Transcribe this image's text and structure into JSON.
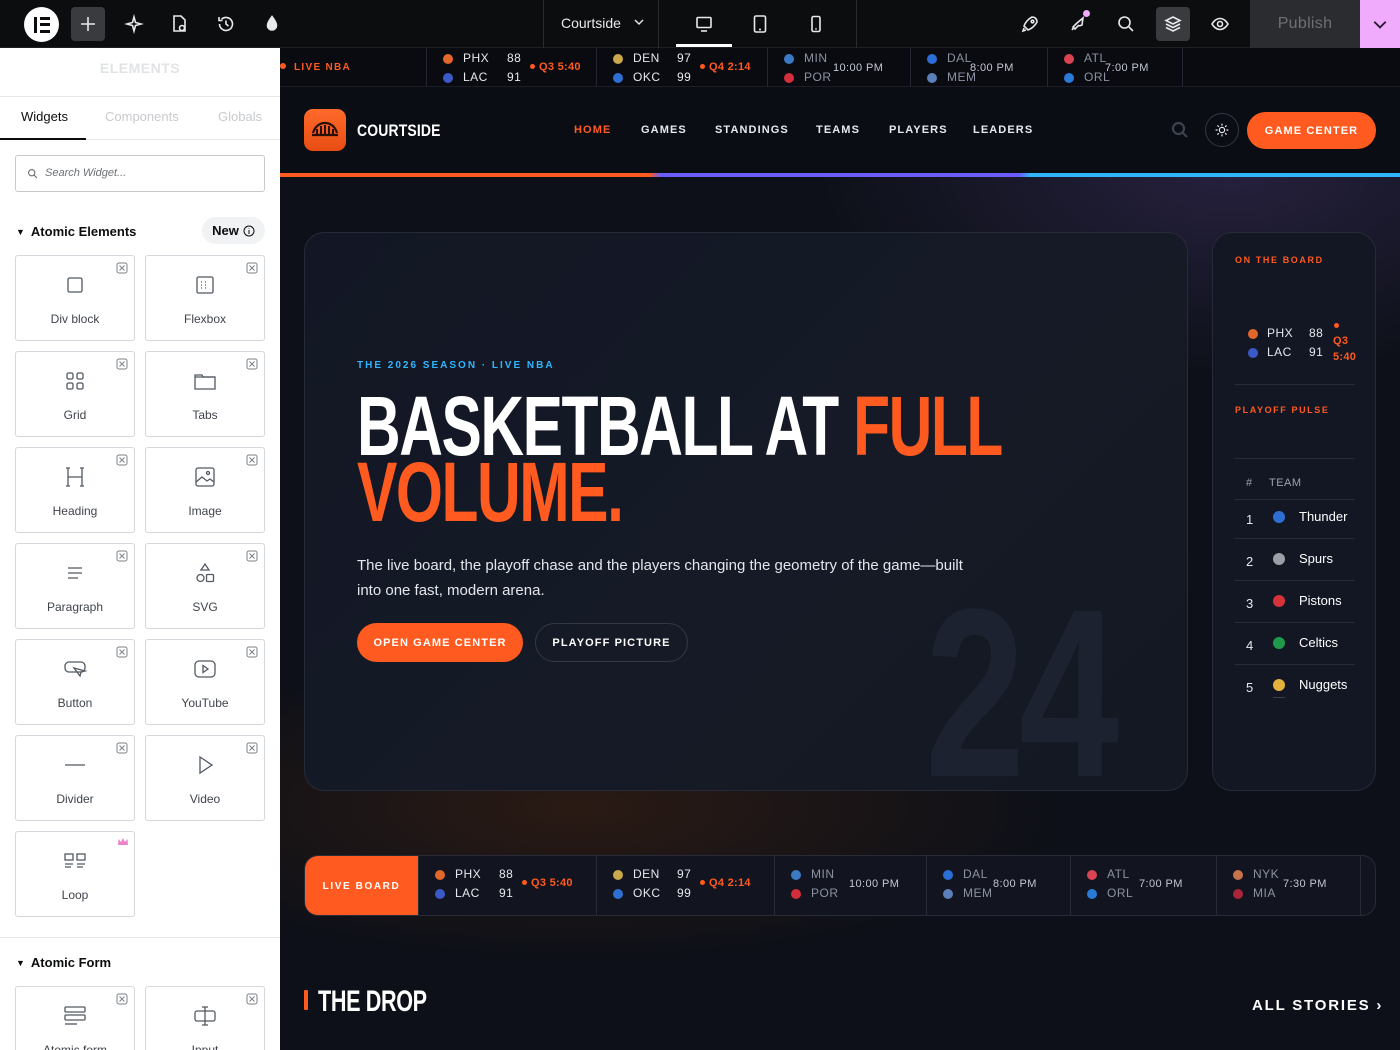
{
  "editor": {
    "site_selector": "Courtside",
    "publish_label": "Publish",
    "toolbar_icons": [
      "elementor-logo-icon",
      "add-icon",
      "ai-sparkle-icon",
      "page-settings-icon",
      "history-icon",
      "theme-style-icon",
      "desktop-icon",
      "tablet-icon",
      "mobile-icon",
      "rocket-icon",
      "notifications-icon",
      "search-icon",
      "structure-icon",
      "preview-icon",
      "chevron-down-icon"
    ],
    "accent_color": "#f0abfc"
  },
  "panel": {
    "title": "ELEMENTS",
    "tabs": [
      "Widgets",
      "Components",
      "Globals"
    ],
    "search_placeholder": "Search Widget...",
    "section_atomic": "Atomic Elements",
    "new_badge": "New",
    "widgets": [
      {
        "label": "Div block",
        "icon": "div-block-icon"
      },
      {
        "label": "Flexbox",
        "icon": "flexbox-icon"
      },
      {
        "label": "Grid",
        "icon": "grid-icon"
      },
      {
        "label": "Tabs",
        "icon": "tabs-icon"
      },
      {
        "label": "Heading",
        "icon": "heading-icon"
      },
      {
        "label": "Image",
        "icon": "image-icon"
      },
      {
        "label": "Paragraph",
        "icon": "paragraph-icon"
      },
      {
        "label": "SVG",
        "icon": "svg-icon"
      },
      {
        "label": "Button",
        "icon": "button-icon"
      },
      {
        "label": "YouTube",
        "icon": "youtube-icon"
      },
      {
        "label": "Divider",
        "icon": "divider-icon"
      },
      {
        "label": "Video",
        "icon": "video-icon"
      },
      {
        "label": "Loop",
        "icon": "loop-icon"
      }
    ],
    "section_form": "Atomic Form",
    "form_widgets": [
      {
        "label": "Atomic form",
        "icon": "form-icon"
      },
      {
        "label": "Input",
        "icon": "input-icon"
      }
    ]
  },
  "site": {
    "ticker": {
      "label": "LIVE NBA",
      "games": [
        {
          "t1": "PHX",
          "s1": "88",
          "t2": "LAC",
          "s2": "91",
          "status": "Q3 5:40",
          "live": true
        },
        {
          "t1": "DEN",
          "s1": "97",
          "t2": "OKC",
          "s2": "99",
          "status": "Q4 2:14",
          "live": true
        },
        {
          "t1": "MIN",
          "s1": "",
          "t2": "POR",
          "s2": "",
          "status": "10:00 PM",
          "live": false
        },
        {
          "t1": "DAL",
          "s1": "",
          "t2": "MEM",
          "s2": "",
          "status": "8:00 PM",
          "live": false
        },
        {
          "t1": "ATL",
          "s1": "",
          "t2": "ORL",
          "s2": "",
          "status": "7:00 PM",
          "live": false
        }
      ]
    },
    "brand": "COURTSIDE",
    "nav": [
      "HOME",
      "GAMES",
      "STANDINGS",
      "TEAMS",
      "PLAYERS",
      "LEADERS"
    ],
    "nav_active": "HOME",
    "game_center_btn": "GAME CENTER",
    "hero": {
      "eyebrow": "THE 2026 SEASON · LIVE NBA",
      "title_white": "BASKETBALL AT ",
      "title_orange_1": "FULL",
      "title_orange_2": "VOLUME.",
      "lede": "The live board, the playoff chase and the players changing the geometry of the game—built into one fast, modern arena.",
      "cta_primary": "OPEN GAME CENTER",
      "cta_secondary": "PLAYOFF PICTURE",
      "bg_number": "24"
    },
    "sidebar": {
      "on_board": "ON THE BOARD",
      "board_game": {
        "t1": "PHX",
        "s1": "88",
        "t2": "LAC",
        "s2": "91",
        "status_1": "Q3",
        "status_2": "5:40"
      },
      "playoff": "PLAYOFF PULSE",
      "col_rank": "#",
      "col_team": "TEAM",
      "standings": [
        {
          "rank": "1",
          "team": "Thunder",
          "color": "#2f6fd1"
        },
        {
          "rank": "2",
          "team": "Spurs",
          "color": "#9aa0a6"
        },
        {
          "rank": "3",
          "team": "Pistons",
          "color": "#d6323a"
        },
        {
          "rank": "4",
          "team": "Celtics",
          "color": "#1f9a4a"
        },
        {
          "rank": "5",
          "team": "Nuggets",
          "color": "#e3b23c"
        }
      ]
    },
    "live_board": {
      "label": "LIVE BOARD",
      "games": [
        {
          "t1": "PHX",
          "s1": "88",
          "t2": "LAC",
          "s2": "91",
          "status": "Q3 5:40",
          "live": true
        },
        {
          "t1": "DEN",
          "s1": "97",
          "t2": "OKC",
          "s2": "99",
          "status": "Q4 2:14",
          "live": true
        },
        {
          "t1": "MIN",
          "s1": "",
          "t2": "POR",
          "s2": "",
          "status": "10:00 PM",
          "live": false
        },
        {
          "t1": "DAL",
          "s1": "",
          "t2": "MEM",
          "s2": "",
          "status": "8:00 PM",
          "live": false
        },
        {
          "t1": "ATL",
          "s1": "",
          "t2": "ORL",
          "s2": "",
          "status": "7:00 PM",
          "live": false
        },
        {
          "t1": "NYK",
          "s1": "",
          "t2": "MIA",
          "s2": "",
          "status": "7:30 PM",
          "live": false
        }
      ]
    },
    "drop_title": "THE DROP",
    "all_stories": "ALL STORIES ›"
  }
}
